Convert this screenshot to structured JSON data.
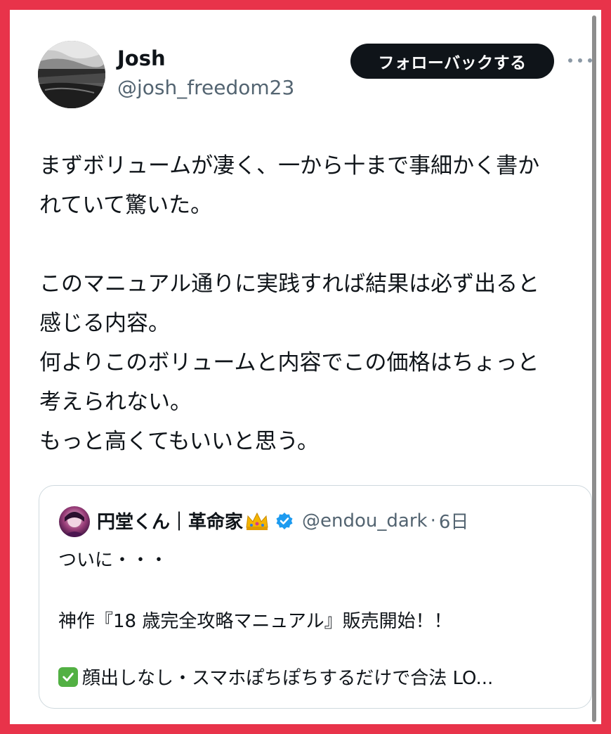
{
  "post": {
    "author_name": "Josh",
    "author_handle": "@josh_freedom23",
    "follow_button_label": "フォローバックする",
    "more_icon": "more-horizontal-icon",
    "text_lines": [
      "まずボリュームが凄く、一から十まで事細かく書か",
      "れていて驚いた。",
      "",
      "このマニュアル通りに実践すれば結果は必ず出ると",
      "感じる内容。",
      "何よりこのボリュームと内容でこの価格はちょっと",
      "考えられない。",
      "もっと高くてもいいと思う。"
    ]
  },
  "quoted_post": {
    "author_name": "円堂くん｜革命家",
    "crown_icon": "crown-icon",
    "verified_icon": "verified-badge-icon",
    "author_handle": "@endou_dark",
    "separator": "·",
    "time": "6日",
    "line1": "ついに・・・",
    "line2": "神作『18 歳完全攻略マニュアル』販売開始！！",
    "line3": "顔出しなし・スマホぽちぽちするだけで合法 LO..."
  },
  "colors": {
    "frame": "#e8334a",
    "text_primary": "#0f1419",
    "text_secondary": "#536471",
    "button_bg": "#0f1419",
    "verified": "#1d9bf0",
    "check_green": "#52b043"
  }
}
